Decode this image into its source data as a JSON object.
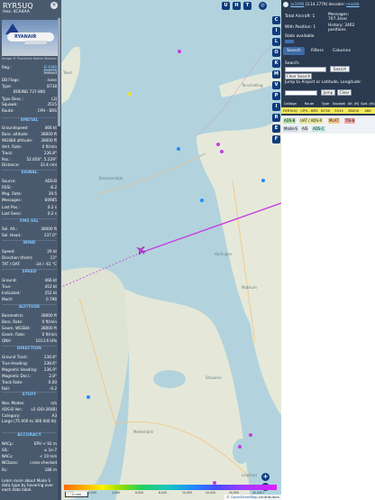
{
  "aircraft": {
    "callsign": "RYR5UQ",
    "hex_line": "Hex:  4CA4AA",
    "close_glyph": "×",
    "photo_livery": "RYANAIR",
    "photo_credit": "Image © Florencio Martin Moreno",
    "registration": {
      "label": "Reg.:",
      "value": "EI-EMB"
    },
    "country": {
      "label": "",
      "value": "Ireland"
    },
    "db_flags": {
      "label": "DB Flags:",
      "value": "none"
    },
    "type": {
      "label": "Type:",
      "value": "B738"
    },
    "type_full": "BOEING 737-800",
    "type_desc": {
      "label": "Type Desc.:",
      "value": "L2J"
    },
    "squawk": {
      "label": "Squawk:",
      "value": "3515"
    },
    "route": {
      "label": "Route:",
      "value": "CPH - BRS"
    }
  },
  "sections": {
    "spatial": "SPATIAL",
    "signal": "SIGNAL",
    "fms_sel": "FMS SEL",
    "wind": "WIND",
    "speed": "SPEED",
    "altitude": "ALTITUDE",
    "direction": "DIRECTION",
    "stuff": "STUFF",
    "accuracy": "ACCURACY"
  },
  "spatial_rows": [
    {
      "label": "Groundspeed:",
      "value": "466 kt"
    },
    {
      "label": "Baro. altitude:",
      "value": "38000 ft"
    },
    {
      "label": "WGS84 altitude:",
      "value": "38000 ft"
    },
    {
      "label": "Vert. Rate:",
      "value": "0 ft/min"
    },
    {
      "label": "Track:",
      "value": "236.8°"
    },
    {
      "label": "Pos.:",
      "value": "52.850°, 5.229°"
    },
    {
      "label": "Distance:",
      "value": "33.4 nmi"
    }
  ],
  "signal_rows": [
    {
      "label": "Source:",
      "value": "ADS-B"
    },
    {
      "label": "RSSI:",
      "value": "-8.2"
    },
    {
      "label": "Msg. Rate:",
      "value": "39.5"
    },
    {
      "label": "Messages:",
      "value": "60985"
    },
    {
      "label": "Last Pos.:",
      "value": "0.2 s"
    },
    {
      "label": "Last Seen:",
      "value": "0.2 s"
    }
  ],
  "fms_rows": [
    {
      "label": "Sel. Alt.:",
      "value": "38000 ft"
    },
    {
      "label": "Sel. Head.:",
      "value": "237.0°"
    }
  ],
  "wind_rows": [
    {
      "label": "Speed:",
      "value": "20 kt"
    },
    {
      "label": "Direction (from):",
      "value": "13°"
    },
    {
      "label": "TAT / OAT:",
      "value": "-34 / -61 °C"
    }
  ],
  "speed_rows": [
    {
      "label": "Ground:",
      "value": "466 kt"
    },
    {
      "label": "True:",
      "value": "452 kt"
    },
    {
      "label": "Indicated:",
      "value": "252 kt"
    },
    {
      "label": "Mach:",
      "value": "0.796"
    }
  ],
  "altitude_rows": [
    {
      "label": "Barometric:",
      "value": "38000 ft"
    },
    {
      "label": "Baro. Rate:",
      "value": "0 ft/min"
    },
    {
      "label": "Geom. WGS84:",
      "value": "38000 ft"
    },
    {
      "label": "Geom. Rate:",
      "value": "0 ft/min"
    },
    {
      "label": "QNH:",
      "value": "1013.6 hPa"
    }
  ],
  "direction_rows": [
    {
      "label": "Ground Track:",
      "value": "236.8°"
    },
    {
      "label": "True Heading:",
      "value": "238.6°"
    },
    {
      "label": "Magnetic Heading:",
      "value": "236.9°"
    },
    {
      "label": "Magnetic Decl.:",
      "value": "2.8°"
    },
    {
      "label": "Track Rate:",
      "value": "0.00"
    },
    {
      "label": "Roll:",
      "value": "-0.2"
    }
  ],
  "stuff_rows": [
    {
      "label": "Nav. Modes:",
      "value": "n/a"
    },
    {
      "label": "ADS-B Ver.:",
      "value": "v2 (DO-260B)"
    },
    {
      "label": "Category:",
      "value": "A3"
    }
  ],
  "stuff_category_desc": "Large (75 000 to 300 000 lb)",
  "accuracy_rows": [
    {
      "label": "NACp:",
      "value": "EPU < 92 m"
    },
    {
      "label": "SIL:",
      "value": "≤ 1e-7"
    },
    {
      "label": "NACv:",
      "value": "< 10 m/s"
    },
    {
      "label": "NICbaro:",
      "value": "cross-checked"
    },
    {
      "label": "Rc:",
      "value": "186 m"
    }
  ],
  "accuracy_help": {
    "prefix": "Learn more about Mode S data type by hovering over each data label.",
    "link": ""
  },
  "map": {
    "place_labels": [
      "Breezanddijk",
      "Texel",
      "Terschelling",
      "Vlieland",
      "Harlingen",
      "Den Helder",
      "Medemblik",
      "Enkhuizen",
      "Makkum",
      "Bolsward",
      "Stavoren",
      "Lelystad",
      "Wieringermeer"
    ],
    "top_buttons": [
      "U",
      "H",
      "T"
    ],
    "side_buttons": [
      "C",
      "I",
      "L",
      "O",
      "K",
      "M",
      "V",
      "P",
      "I",
      "R",
      "E",
      "F"
    ],
    "zoom_in": "+",
    "zoom_out": "−",
    "scale": "2 nmi",
    "legend_ticks": [
      "1,000",
      "2,000",
      "4,000",
      "6,000",
      "8,000",
      "10,000",
      "20,000",
      "30,000",
      "40,000+"
    ],
    "attribution_prefix": "© ",
    "attribution_link": "OpenStreetMap",
    "attribution_suffix": " contributors",
    "selected_color": "#c43ee0",
    "label_color": "#6b7f86"
  },
  "right": {
    "header_link": "ar1090",
    "header_text": "(3.14.1779) decoder:",
    "header_link2": "readsb",
    "total_aircraft": "Total Aircraft: 1",
    "messages": "Messages:",
    "messages_value": "707.3/sec",
    "with_position": "With Position: 1",
    "history": "History: 3462",
    "history_suffix": "positions",
    "stats_available": "Stats available",
    "tabs": [
      "Search",
      "Filters",
      "Columns"
    ],
    "search_label": "Search:",
    "search_placeholder": "",
    "search_button": "Search",
    "clear_search": "Clear Search",
    "jump_label": "Jump to Airport or Latitude, Longitude:",
    "jump_placeholder": "",
    "jump_button": "Jump",
    "clear_button": "Clear",
    "columns": [
      "Callsign",
      "Route",
      "Type",
      "Squawk",
      "Alt. (ft)",
      "Spd. (kt)"
    ],
    "row": [
      "RYR5UQ",
      "CPH - BRS",
      "B738",
      "3515",
      "38000",
      "466"
    ],
    "sources": [
      {
        "label": "ADS-B",
        "color": "#b5e3b0"
      },
      {
        "label": "UAT / ADS-R",
        "color": "#e8e8a0"
      },
      {
        "label": "MLAT",
        "color": "#f6c890"
      },
      {
        "label": "TIS-B",
        "color": "#f4a7a7"
      },
      {
        "label": "Mode-S",
        "color": "#cfd8e6"
      },
      {
        "label": "AIS",
        "color": "#dcdcdc"
      },
      {
        "label": "ADS-C",
        "color": "#b8e6e0"
      }
    ]
  }
}
